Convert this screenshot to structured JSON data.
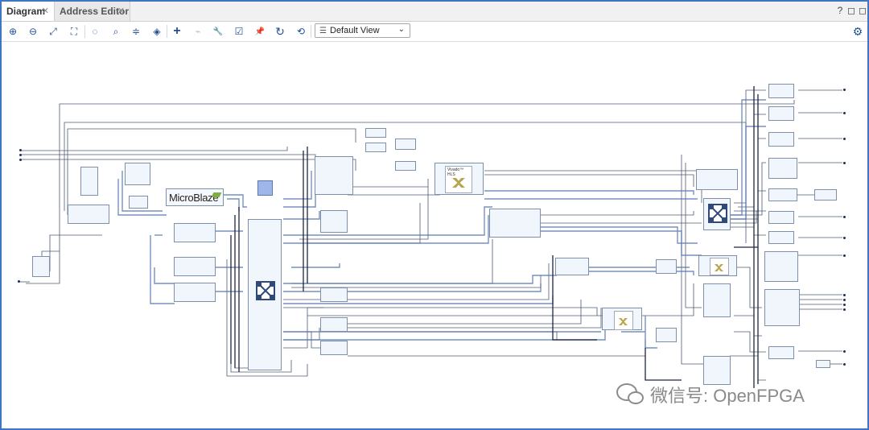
{
  "tabs": [
    {
      "label": "Diagram",
      "active": true
    },
    {
      "label": "Address Editor",
      "active": false
    }
  ],
  "window_controls": {
    "help": "?",
    "restore": "◻",
    "maximize": "◻"
  },
  "toolbar": {
    "buttons": [
      {
        "name": "zoom-in-icon",
        "glyph": "⊕"
      },
      {
        "name": "zoom-out-icon",
        "glyph": "⊖"
      },
      {
        "name": "fit-view-icon",
        "glyph": "⤢"
      },
      {
        "name": "zoom-area-icon",
        "glyph": "⛶"
      },
      {
        "name": "select-area-icon",
        "glyph": "◌"
      },
      {
        "name": "search-icon",
        "glyph": "⌕"
      },
      {
        "name": "collapse-icon",
        "glyph": "≑"
      },
      {
        "name": "expand-icon",
        "glyph": "◈"
      },
      {
        "name": "add-ip-icon",
        "glyph": "+"
      },
      {
        "name": "make-connection-icon",
        "glyph": "⌁"
      },
      {
        "name": "settings-wrench-icon",
        "glyph": "🔧"
      },
      {
        "name": "validate-design-icon",
        "glyph": "☑"
      },
      {
        "name": "pin-icon",
        "glyph": "📌"
      },
      {
        "name": "regenerate-layout-icon",
        "glyph": "↻"
      },
      {
        "name": "optimize-routing-icon",
        "glyph": "⟲"
      }
    ],
    "view_select": {
      "value": "Default View",
      "icon": "list-icon"
    },
    "gear_icon": "⚙"
  },
  "diagram": {
    "microblaze_label": "MicroBlaze",
    "hls_label": "Vivado™ HLS",
    "blocks_semantic": "block-design-ip"
  },
  "watermark": {
    "text": "微信号: OpenFPGA"
  }
}
